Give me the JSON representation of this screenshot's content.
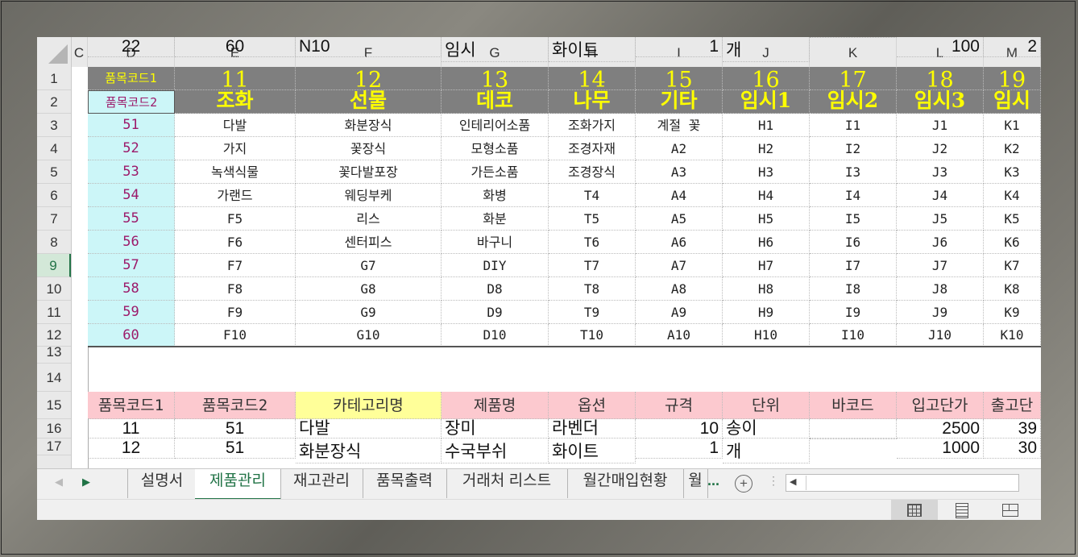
{
  "columns": [
    "C",
    "D",
    "E",
    "F",
    "G",
    "H",
    "I",
    "J",
    "K",
    "L",
    "M"
  ],
  "rows": [
    "1",
    "2",
    "3",
    "4",
    "5",
    "6",
    "7",
    "8",
    "9",
    "10",
    "11",
    "12",
    "13",
    "14",
    "15",
    "16",
    "17"
  ],
  "selected_row": "9",
  "row1": {
    "label": "품목코드1",
    "values": [
      "11",
      "12",
      "13",
      "14",
      "15",
      "16",
      "17",
      "18",
      "19"
    ]
  },
  "row2": {
    "label": "품목코드2",
    "values": [
      "조화",
      "선물",
      "데코",
      "나무",
      "기타",
      "임시1",
      "임시2",
      "임시3",
      "임시"
    ]
  },
  "code_rows": [
    {
      "id": "51",
      "cells": [
        "다발",
        "화분장식",
        "인테리어소품",
        "조화가지",
        "계절 꽃",
        "H1",
        "I1",
        "J1",
        "K1"
      ]
    },
    {
      "id": "52",
      "cells": [
        "가지",
        "꽃장식",
        "모형소품",
        "조경자재",
        "A2",
        "H2",
        "I2",
        "J2",
        "K2"
      ]
    },
    {
      "id": "53",
      "cells": [
        "녹색식물",
        "꽃다발포장",
        "가든소품",
        "조경장식",
        "A3",
        "H3",
        "I3",
        "J3",
        "K3"
      ]
    },
    {
      "id": "54",
      "cells": [
        "가랜드",
        "웨딩부케",
        "화병",
        "T4",
        "A4",
        "H4",
        "I4",
        "J4",
        "K4"
      ]
    },
    {
      "id": "55",
      "cells": [
        "F5",
        "리스",
        "화분",
        "T5",
        "A5",
        "H5",
        "I5",
        "J5",
        "K5"
      ]
    },
    {
      "id": "56",
      "cells": [
        "F6",
        "센터피스",
        "바구니",
        "T6",
        "A6",
        "H6",
        "I6",
        "J6",
        "K6"
      ]
    },
    {
      "id": "57",
      "cells": [
        "F7",
        "G7",
        "DIY",
        "T7",
        "A7",
        "H7",
        "I7",
        "J7",
        "K7"
      ]
    },
    {
      "id": "58",
      "cells": [
        "F8",
        "G8",
        "D8",
        "T8",
        "A8",
        "H8",
        "I8",
        "J8",
        "K8"
      ]
    },
    {
      "id": "59",
      "cells": [
        "F9",
        "G9",
        "D9",
        "T9",
        "A9",
        "H9",
        "I9",
        "J9",
        "K9"
      ]
    },
    {
      "id": "60",
      "cells": [
        "F10",
        "G10",
        "D10",
        "T10",
        "A10",
        "H10",
        "I10",
        "J10",
        "K10"
      ]
    }
  ],
  "table_headers": [
    "품목코드1",
    "품목코드2",
    "카테고리명",
    "제품명",
    "옵션",
    "규격",
    "단위",
    "바코드",
    "입고단가",
    "출고단"
  ],
  "data_rows": [
    [
      "11",
      "51",
      "다발",
      "장미",
      "라벤더",
      "10",
      "송이",
      "",
      "2500",
      "39"
    ],
    [
      "12",
      "51",
      "화분장식",
      "수국부쉬",
      "화이트",
      "1",
      "개",
      "",
      "1000",
      "30"
    ],
    [
      "22",
      "60",
      "N10",
      "임시",
      "화이트",
      "1",
      "개",
      "",
      "100",
      "2"
    ]
  ],
  "sheet_tabs": [
    "설명서",
    "제품관리",
    "재고관리",
    "품목출력",
    "거래처 리스트",
    "월간매입현황",
    "월"
  ],
  "active_tab": "제품관리",
  "more_tabs_label": "...",
  "colors": {
    "header_gray": "#7f7f7f",
    "header_text": "#ffff00",
    "cyan": "#ccf6f8",
    "pink": "#fcc9cf",
    "yellow": "#ffff99",
    "excel_green": "#217346"
  }
}
